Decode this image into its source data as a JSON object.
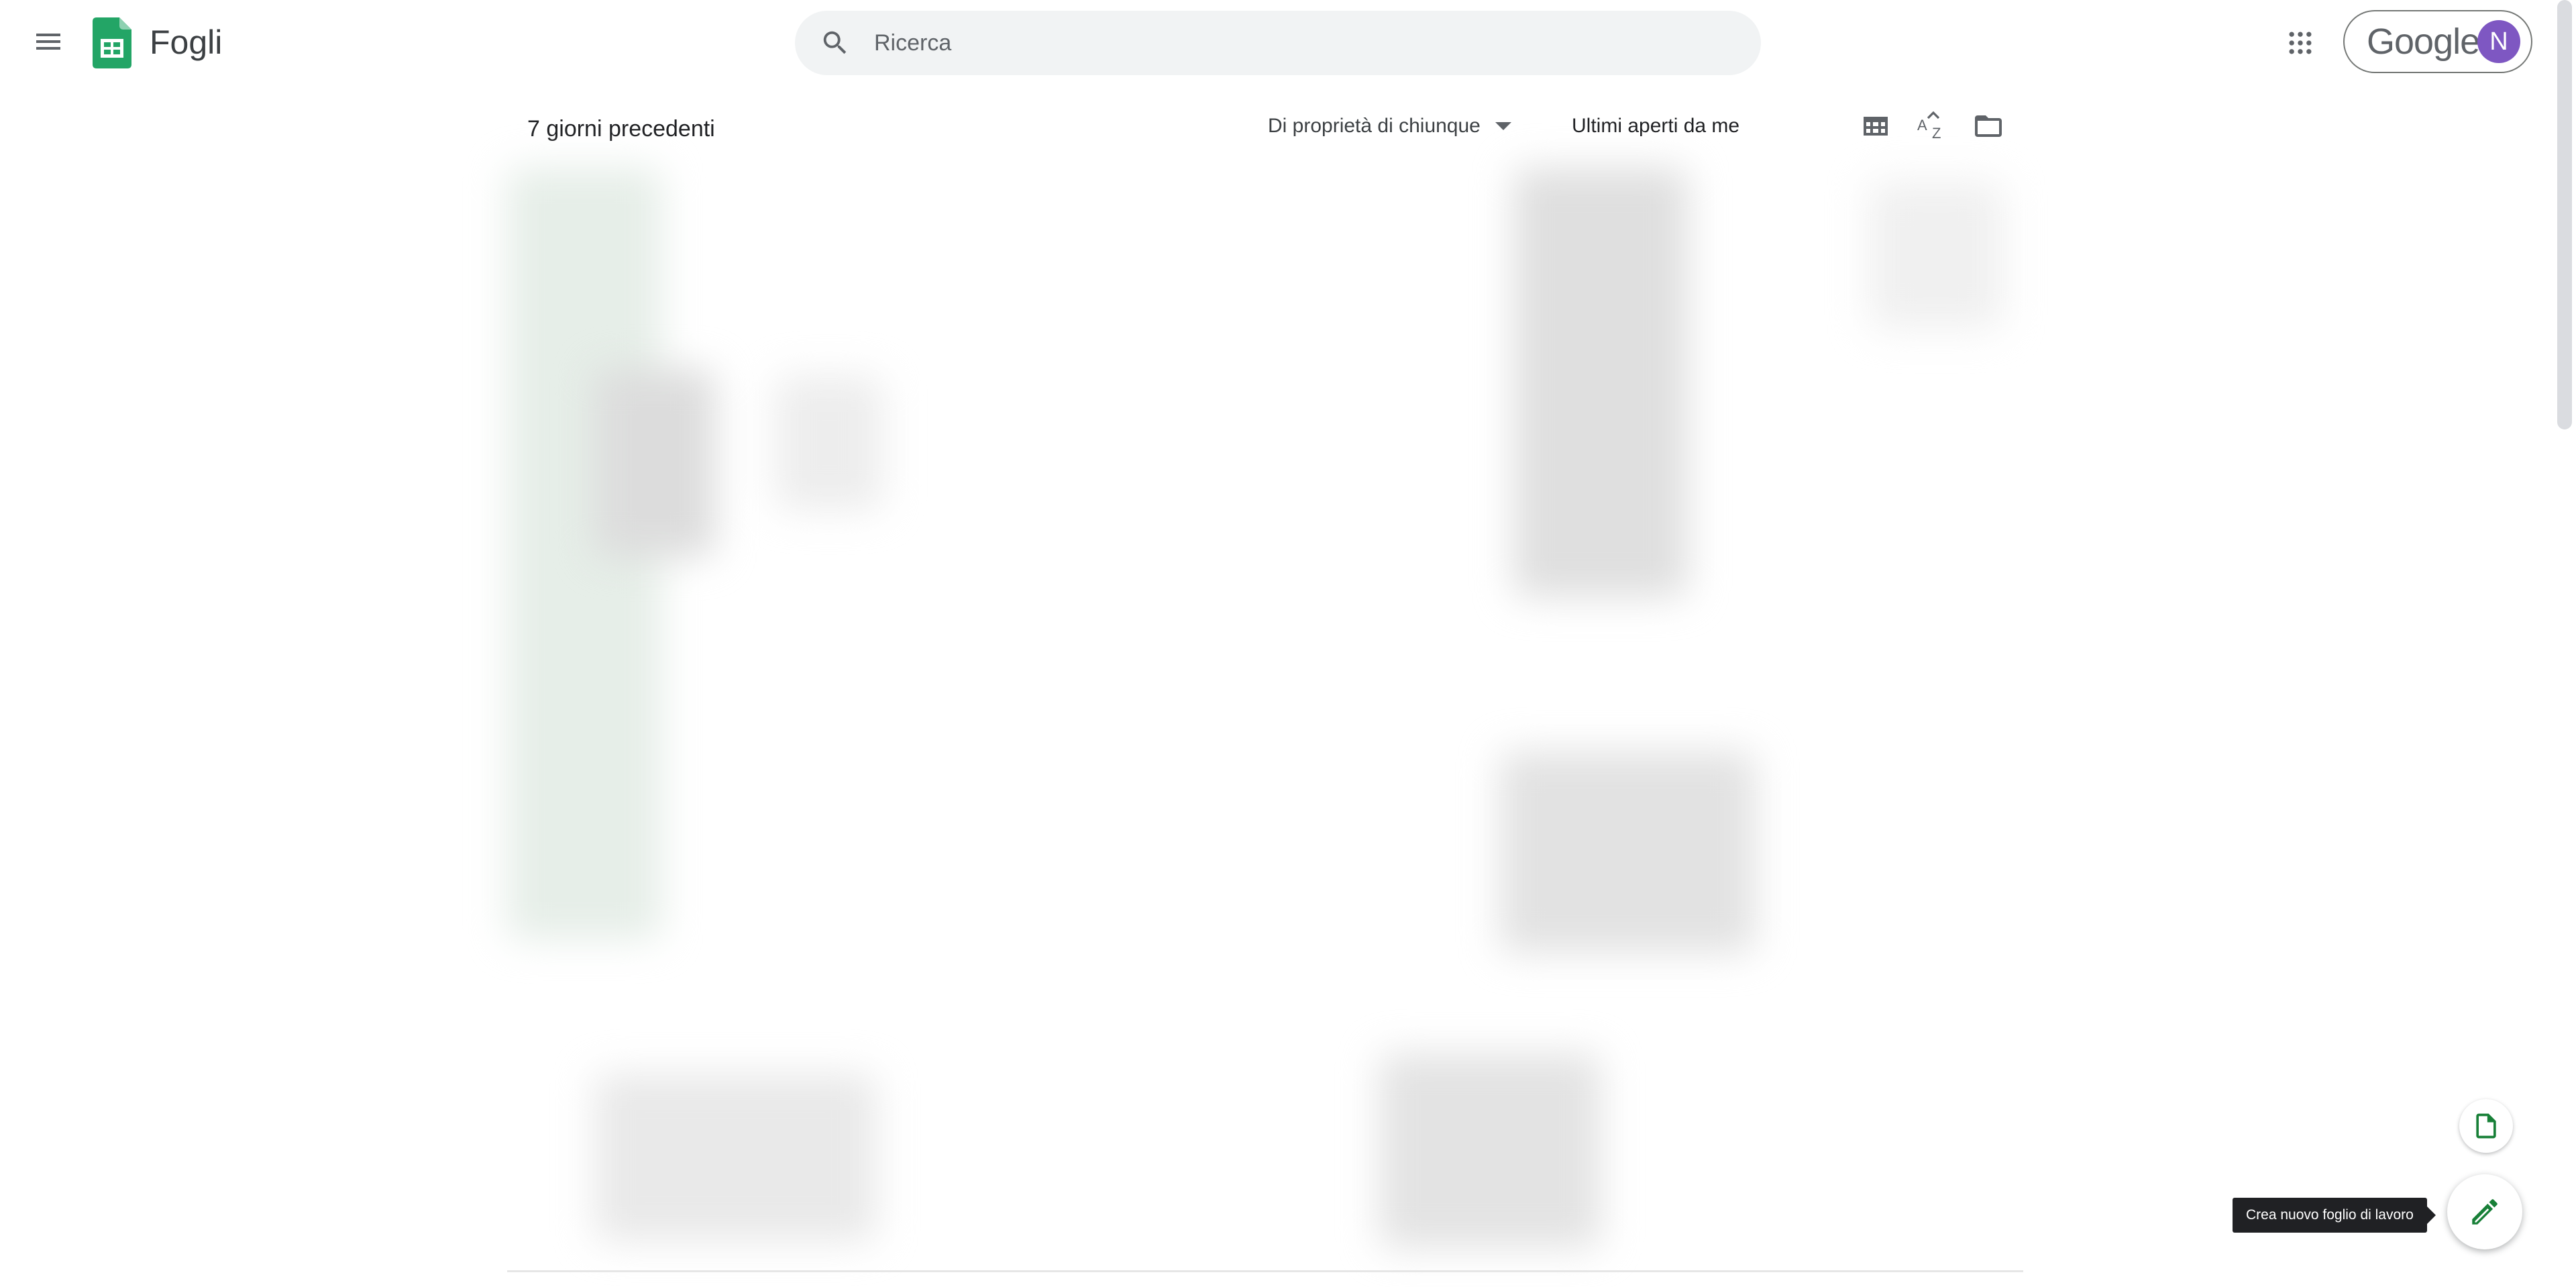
{
  "header": {
    "app_title": "Fogli",
    "search_placeholder": "Ricerca",
    "account_brand": "Google",
    "avatar_initial": "N"
  },
  "toolbar": {
    "section_title": "7 giorni precedenti",
    "owner_filter": "Di proprietà di chiunque",
    "sort_label": "Ultimi aperti da me"
  },
  "fab": {
    "tooltip": "Crea nuovo foglio di lavoro"
  },
  "icons": {
    "menu": "menu-icon",
    "logo": "sheets-logo-icon",
    "search": "search-icon",
    "apps": "apps-grid-icon",
    "grid_view": "grid-view-icon",
    "sort": "sort-az-icon",
    "folder": "folder-icon",
    "new_file": "new-file-icon",
    "edit": "pencil-icon"
  },
  "colors": {
    "sheets_green": "#188038",
    "avatar": "#7e57c2",
    "search_bg": "#f1f3f4",
    "tooltip_bg": "#202124"
  }
}
